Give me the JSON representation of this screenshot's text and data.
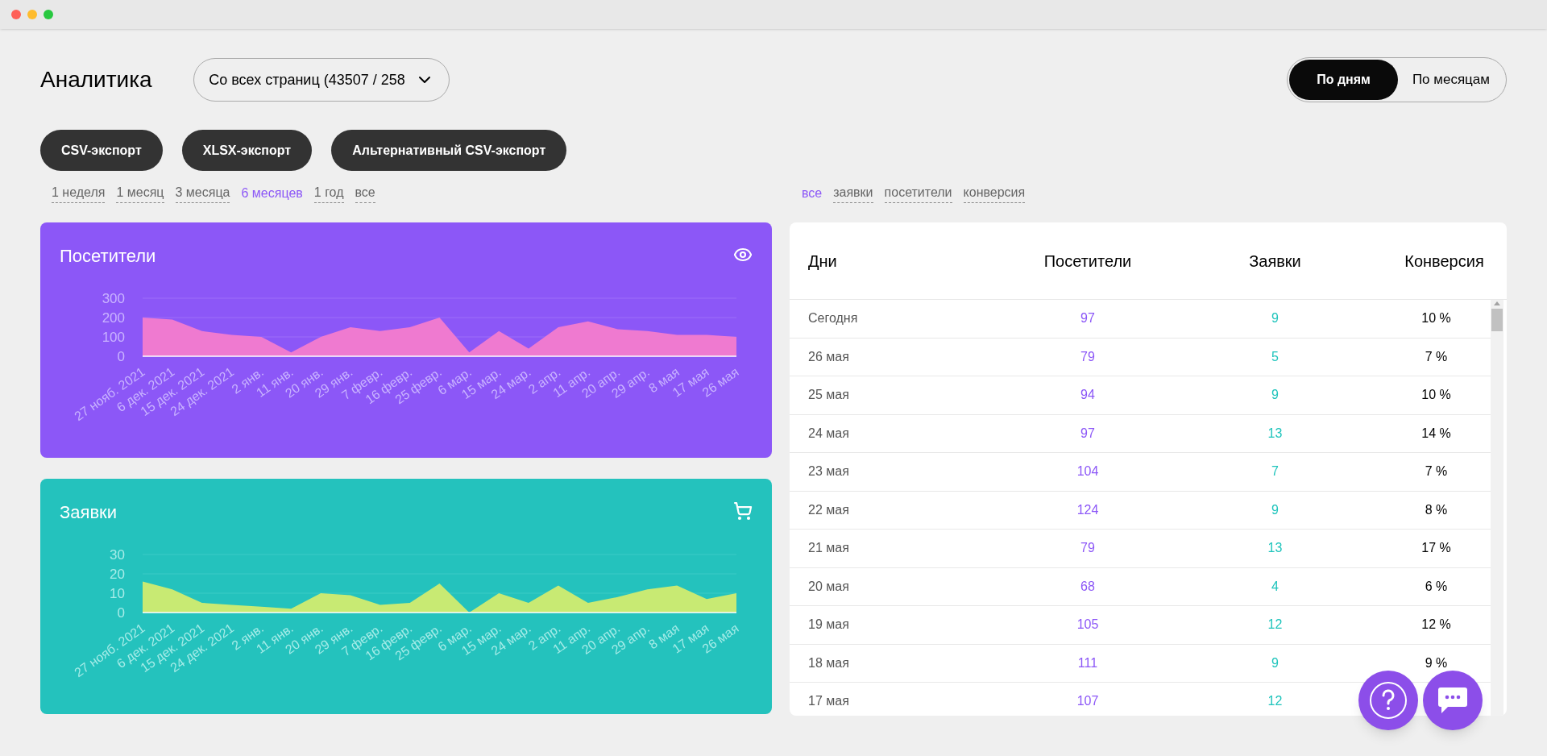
{
  "header": {
    "title": "Аналитика",
    "source_dropdown": "Со всех страниц (43507 / 258",
    "view_toggle": [
      {
        "label": "По дням",
        "selected": true
      },
      {
        "label": "По месяцам",
        "selected": false
      }
    ]
  },
  "export_buttons": [
    "CSV-экспорт",
    "XLSX-экспорт",
    "Альтернативный CSV-экспорт"
  ],
  "periods": [
    {
      "label": "1 неделя",
      "selected": false
    },
    {
      "label": "1 месяц",
      "selected": false
    },
    {
      "label": "3 месяца",
      "selected": false
    },
    {
      "label": "6 месяцев",
      "selected": true
    },
    {
      "label": "1 год",
      "selected": false
    },
    {
      "label": "все",
      "selected": false
    }
  ],
  "filters": [
    {
      "label": "все",
      "selected": true
    },
    {
      "label": "заявки",
      "selected": false
    },
    {
      "label": "посетители",
      "selected": false
    },
    {
      "label": "конверсия",
      "selected": false
    }
  ],
  "cards": [
    {
      "title": "Посетители",
      "kind": "visitors",
      "chart_data": {
        "type": "area",
        "ylim": [
          0,
          300
        ],
        "yticks": [
          0,
          100,
          200,
          300
        ],
        "categories": [
          "27 нояб. 2021",
          "6 дек. 2021",
          "15 дек. 2021",
          "24 дек. 2021",
          "2 янв.",
          "11 янв.",
          "20 янв.",
          "29 янв.",
          "7 февр.",
          "16 февр.",
          "25 февр.",
          "6 мар.",
          "15 мар.",
          "24 мар.",
          "2 апр.",
          "11 апр.",
          "20 апр.",
          "29 апр.",
          "8 мая",
          "17 мая",
          "26 мая"
        ],
        "series": [
          {
            "color": "#ef7ad0",
            "values": [
              200,
              190,
              130,
              110,
              100,
              20,
              100,
              150,
              130,
              150,
              200,
              20,
              130,
              40,
              150,
              180,
              140,
              130,
              110,
              110,
              100
            ]
          }
        ]
      }
    },
    {
      "title": "Заявки",
      "kind": "requests",
      "chart_data": {
        "type": "area",
        "ylim": [
          0,
          30
        ],
        "yticks": [
          0,
          10,
          20,
          30
        ],
        "categories": [
          "27 нояб. 2021",
          "6 дек. 2021",
          "15 дек. 2021",
          "24 дек. 2021",
          "2 янв.",
          "11 янв.",
          "20 янв.",
          "29 янв.",
          "7 февр.",
          "16 февр.",
          "25 февр.",
          "6 мар.",
          "15 мар.",
          "24 мар.",
          "2 апр.",
          "11 апр.",
          "20 апр.",
          "29 апр.",
          "8 мая",
          "17 мая",
          "26 мая"
        ],
        "series": [
          {
            "color": "#c8ea73",
            "values": [
              16,
              12,
              5,
              4,
              3,
              2,
              10,
              9,
              4,
              5,
              15,
              0,
              10,
              5,
              14,
              5,
              8,
              12,
              14,
              7,
              10
            ]
          }
        ]
      }
    }
  ],
  "table": {
    "columns": [
      "Дни",
      "Посетители",
      "Заявки",
      "Конверсия"
    ],
    "rows": [
      {
        "day": "Сегодня",
        "visitors": "97",
        "requests": "9",
        "conversion": "10 %"
      },
      {
        "day": "26 мая",
        "visitors": "79",
        "requests": "5",
        "conversion": "7 %"
      },
      {
        "day": "25 мая",
        "visitors": "94",
        "requests": "9",
        "conversion": "10 %"
      },
      {
        "day": "24 мая",
        "visitors": "97",
        "requests": "13",
        "conversion": "14 %"
      },
      {
        "day": "23 мая",
        "visitors": "104",
        "requests": "7",
        "conversion": "7 %"
      },
      {
        "day": "22 мая",
        "visitors": "124",
        "requests": "9",
        "conversion": "8 %"
      },
      {
        "day": "21 мая",
        "visitors": "79",
        "requests": "13",
        "conversion": "17 %"
      },
      {
        "day": "20 мая",
        "visitors": "68",
        "requests": "4",
        "conversion": "6 %"
      },
      {
        "day": "19 мая",
        "visitors": "105",
        "requests": "12",
        "conversion": "12 %"
      },
      {
        "day": "18 мая",
        "visitors": "111",
        "requests": "9",
        "conversion": "9 %"
      },
      {
        "day": "17 мая",
        "visitors": "107",
        "requests": "12"
      }
    ]
  }
}
